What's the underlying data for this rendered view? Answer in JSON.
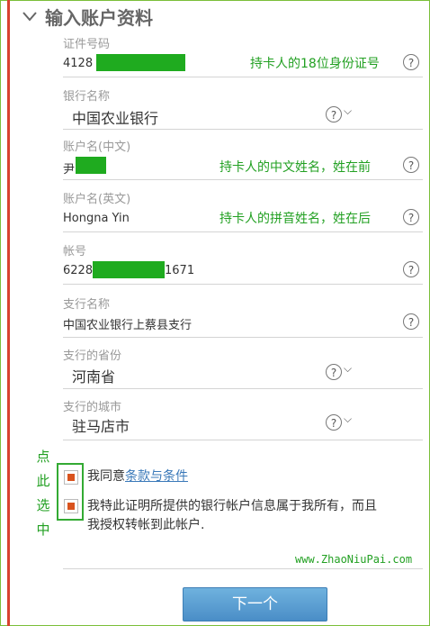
{
  "section_title": "输入账户资料",
  "fields": [
    {
      "label": "证件号码",
      "value": "4128",
      "annotation": "持卡人的18位身份证号"
    },
    {
      "label": "银行名称",
      "value": "中国农业银行"
    },
    {
      "label": "账户名(中文)",
      "value": "尹",
      "annotation": "持卡人的中文姓名，姓在前"
    },
    {
      "label": "账户名(英文)",
      "value": "Hongna Yin",
      "annotation": "持卡人的拼音姓名，姓在后"
    },
    {
      "label": "帐号",
      "value_prefix": "6228",
      "value_suffix": "1671"
    },
    {
      "label": "支行名称",
      "value": "中国农业银行上蔡县支行"
    },
    {
      "label": "支行的省份",
      "value": "河南省"
    },
    {
      "label": "支行的城市",
      "value": "驻马店市"
    }
  ],
  "help_glyph": "?",
  "dropdown_glyph": "⌵",
  "side_note": [
    "点",
    "此",
    "选",
    "中"
  ],
  "agree": {
    "prefix": "我同意",
    "link": "条款与条件"
  },
  "certify": {
    "line1": "我特此证明所提供的银行帐户信息属于我所有，而且",
    "line2": "我授权转帐到此帐户."
  },
  "watermark": "www.ZhaoNiuPai.com",
  "next_button": "下一个",
  "colors": {
    "accent_green": "#22a022",
    "redaction": "#1fab1f",
    "checkbox_mark": "#d9531e",
    "button": "#5a9fd4",
    "left_rule": "#d8412f"
  }
}
